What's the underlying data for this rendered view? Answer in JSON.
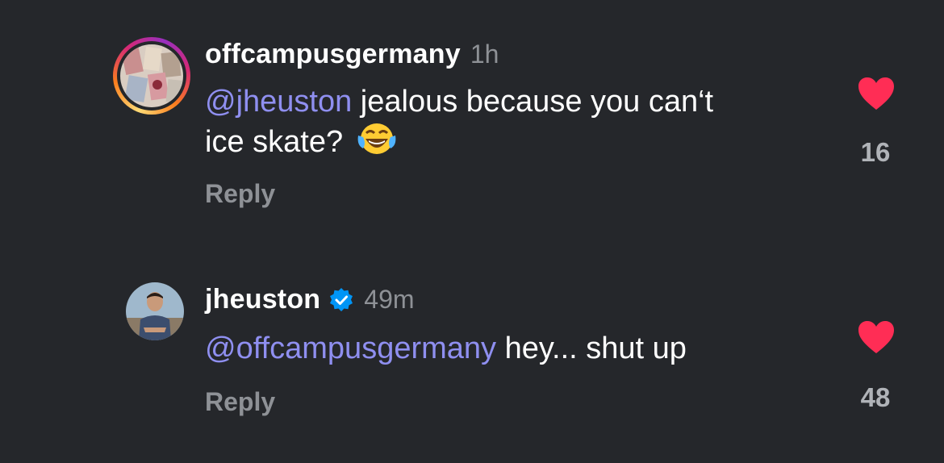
{
  "comments": [
    {
      "username": "offcampusgermany",
      "timestamp": "1h",
      "mention": "@jheuston",
      "text_line1": " jealous because you can‘t",
      "text_line2": "ice skate? ",
      "emoji": "face-with-tears-of-joy",
      "reply_label": "Reply",
      "like_count": "16",
      "has_story_ring": true,
      "verified": false
    },
    {
      "username": "jheuston",
      "timestamp": "49m",
      "mention": "@offcampusgermany",
      "text": " hey... shut up",
      "reply_label": "Reply",
      "like_count": "48",
      "has_story_ring": false,
      "verified": true
    }
  ],
  "colors": {
    "background": "#25272b",
    "mention": "#8f8ff0",
    "heart": "#ff2d55",
    "muted": "#8e9196",
    "verified": "#0095f6"
  }
}
